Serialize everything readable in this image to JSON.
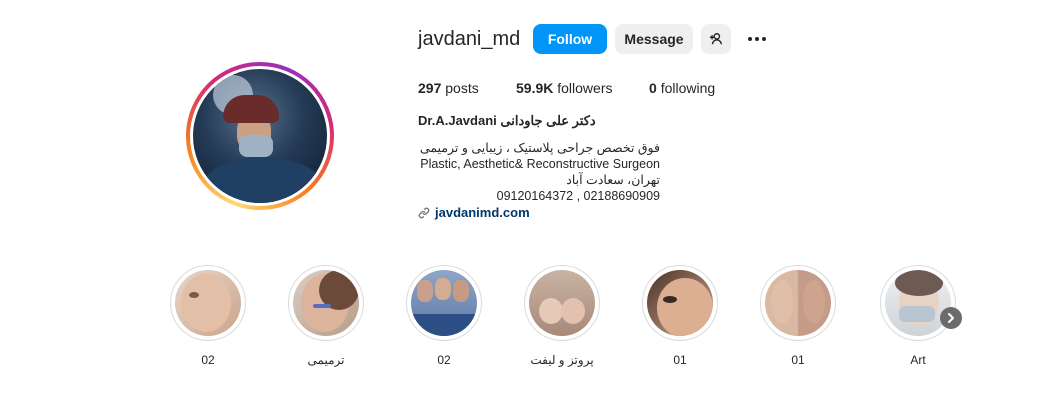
{
  "profile": {
    "username": "javdani_md",
    "follow_label": "Follow",
    "message_label": "Message"
  },
  "stats": {
    "posts_count": "297",
    "posts_label": "posts",
    "followers_count": "59.9K",
    "followers_label": "followers",
    "following_count": "0",
    "following_label": "following"
  },
  "bio": {
    "name": "Dr.A.Javdani دکتر علی جاودانی",
    "lines": [
      "فوق تخصص جراحی پلاستیک ، زیبایی و ترمیمی",
      "Plastic, Aesthetic& Reconstructive Surgeon",
      "تهران، سعادت آباد",
      "09120164372 , 02188690909"
    ],
    "link": "javdanimd.com"
  },
  "highlights": [
    {
      "label": "02"
    },
    {
      "label": "ترمیمی"
    },
    {
      "label": "02"
    },
    {
      "label": "پروتز و لیفت"
    },
    {
      "label": "01"
    },
    {
      "label": "01"
    },
    {
      "label": "Art"
    }
  ],
  "icons": {
    "add_person": "add-person-icon",
    "more": "more-dots-icon",
    "link": "link-icon",
    "next": "chevron-right-icon"
  },
  "colors": {
    "follow_button": "#0095f6",
    "secondary_button": "#efefef",
    "link": "#00376b"
  }
}
